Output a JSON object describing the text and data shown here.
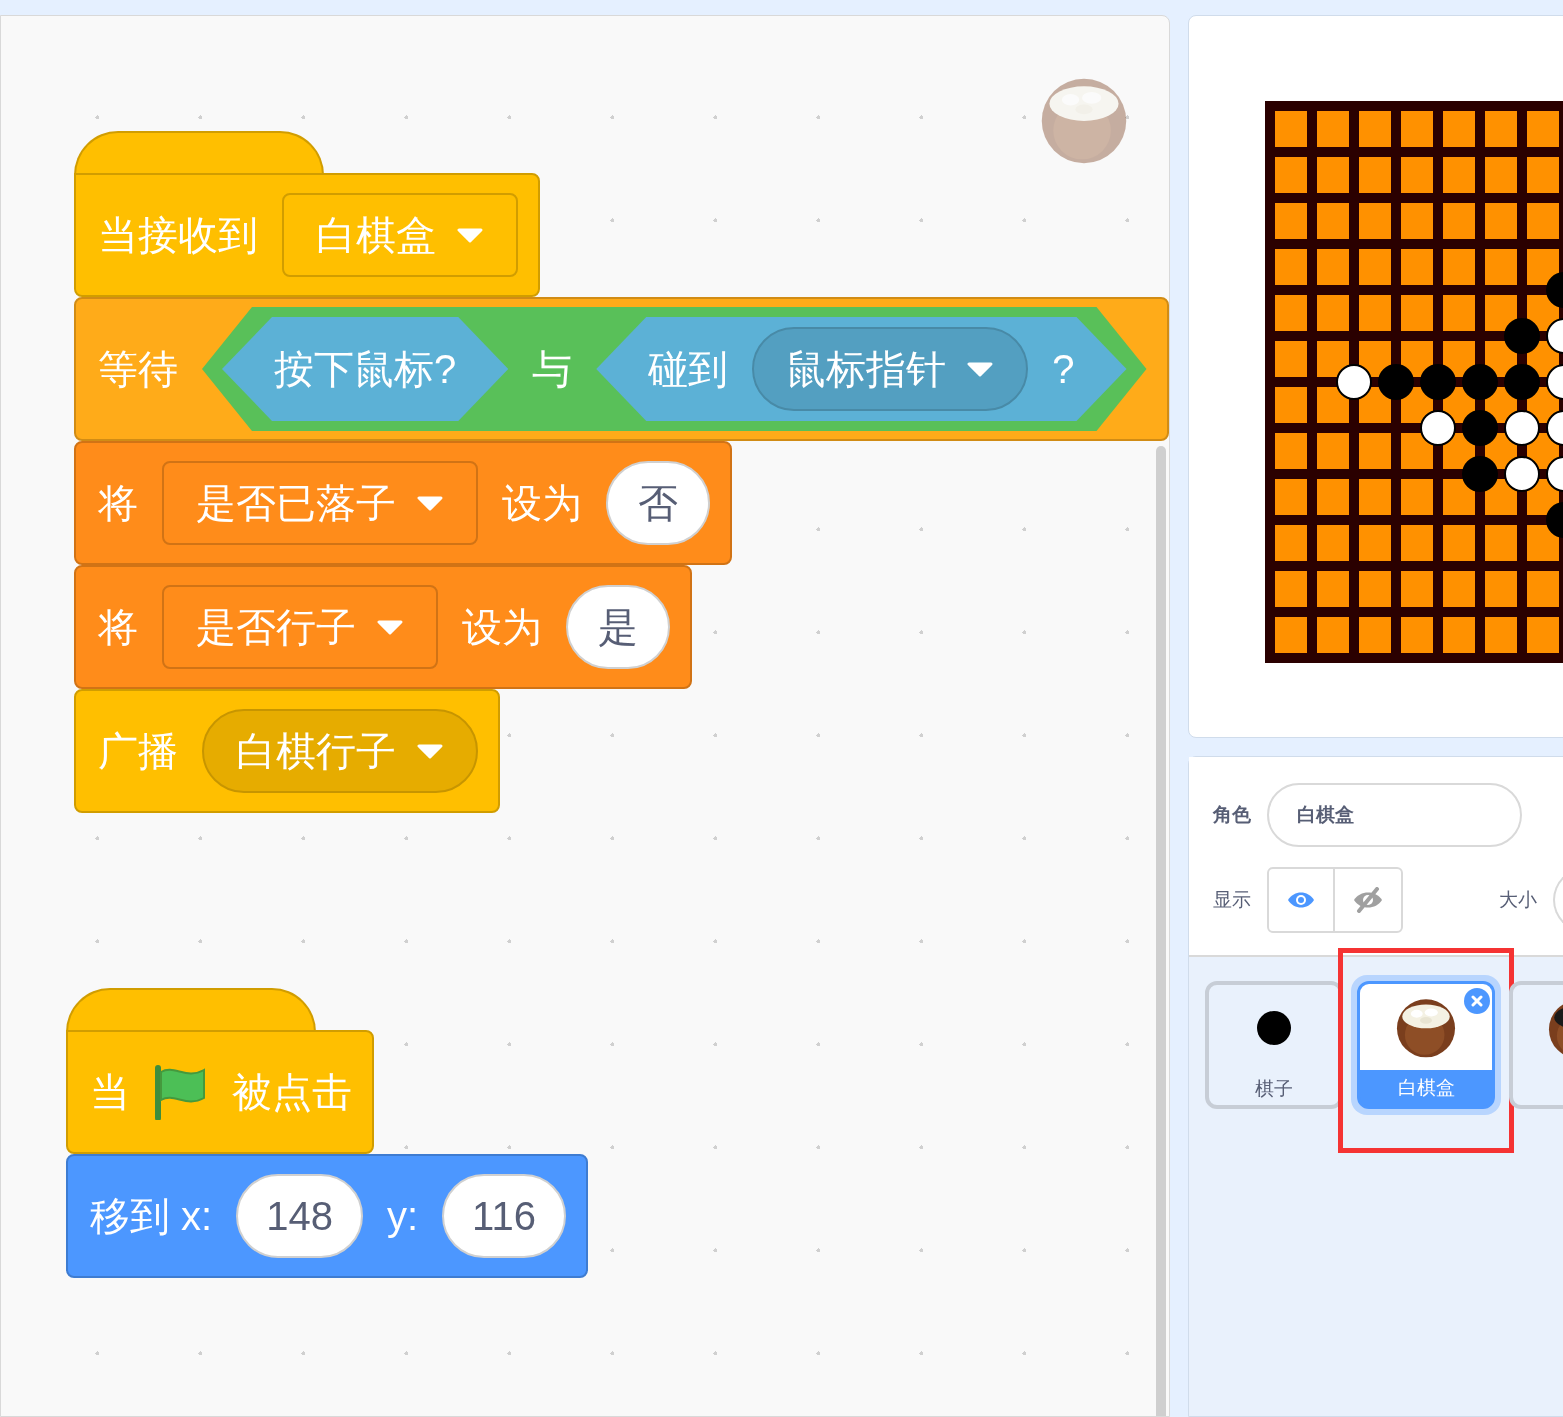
{
  "scripts": [
    {
      "blocks": [
        {
          "kind": "hat",
          "color": "#ffbf00",
          "parts": [
            {
              "kind": "text",
              "text": "当接收到"
            },
            {
              "kind": "dropdown",
              "text": "白棋盒"
            }
          ]
        },
        {
          "kind": "stack",
          "color": "#ffab19",
          "parts": [
            {
              "kind": "text",
              "text": "等待"
            },
            {
              "kind": "boolean",
              "color": "#59c059",
              "parts": [
                {
                  "kind": "boolean",
                  "color": "#5cb1d6",
                  "parts": [
                    {
                      "kind": "text",
                      "text": "按下鼠标?"
                    }
                  ]
                },
                {
                  "kind": "text",
                  "text": "与"
                },
                {
                  "kind": "boolean",
                  "color": "#5cb1d6",
                  "parts": [
                    {
                      "kind": "text",
                      "text": "碰到"
                    },
                    {
                      "kind": "menu",
                      "text": "鼠标指针"
                    },
                    {
                      "kind": "text",
                      "text": "?"
                    }
                  ]
                }
              ]
            }
          ]
        },
        {
          "kind": "stack",
          "color": "#ff8c1a",
          "parts": [
            {
              "kind": "text",
              "text": "将"
            },
            {
              "kind": "dropdown",
              "text": "是否已落子"
            },
            {
              "kind": "text",
              "text": "设为"
            },
            {
              "kind": "input",
              "text": "否"
            }
          ]
        },
        {
          "kind": "stack",
          "color": "#ff8c1a",
          "parts": [
            {
              "kind": "text",
              "text": "将"
            },
            {
              "kind": "dropdown",
              "text": "是否行子"
            },
            {
              "kind": "text",
              "text": "设为"
            },
            {
              "kind": "input",
              "text": "是"
            }
          ]
        },
        {
          "kind": "stack",
          "color": "#ffbf00",
          "parts": [
            {
              "kind": "text",
              "text": "广播"
            },
            {
              "kind": "menu",
              "text": "白棋行子"
            }
          ]
        }
      ]
    },
    {
      "blocks": [
        {
          "kind": "hat",
          "color": "#ffbf00",
          "parts": [
            {
              "kind": "text",
              "text": "当"
            },
            {
              "kind": "flag"
            },
            {
              "kind": "text",
              "text": "被点击"
            }
          ]
        },
        {
          "kind": "stack",
          "color": "#4c97ff",
          "parts": [
            {
              "kind": "text",
              "text": "移到 x:"
            },
            {
              "kind": "input",
              "text": "148"
            },
            {
              "kind": "text",
              "text": "y:"
            },
            {
              "kind": "input",
              "text": "116"
            }
          ]
        }
      ]
    }
  ],
  "sprite_info": {
    "sprite_label": "角色",
    "sprite_name": "白棋盒",
    "show_label": "显示",
    "visible": true,
    "size_label": "大小"
  },
  "sprites": [
    {
      "name": "棋子",
      "kind": "dot",
      "selected": false,
      "annotated": false
    },
    {
      "name": "白棋盒",
      "kind": "bowl",
      "selected": true,
      "annotated": true
    },
    {
      "kind": "dark_bowl",
      "selected": false,
      "annotated": false
    }
  ]
}
